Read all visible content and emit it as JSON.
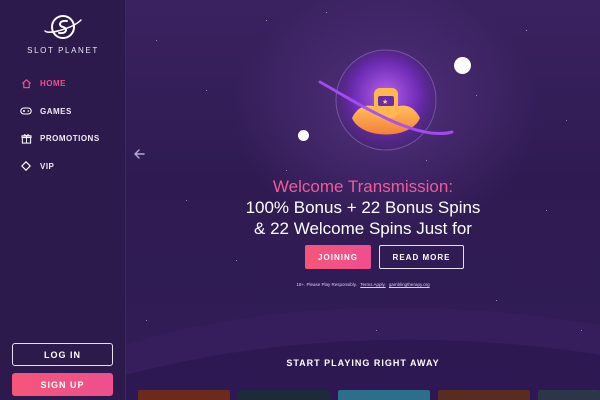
{
  "brand": {
    "name": "SLOT PLANET"
  },
  "sidebar": {
    "items": [
      {
        "label": "HOME",
        "icon": "home-icon",
        "active": true
      },
      {
        "label": "GAMES",
        "icon": "gamepad-icon",
        "active": false
      },
      {
        "label": "PROMOTIONS",
        "icon": "gift-icon",
        "active": false
      },
      {
        "label": "VIP",
        "icon": "diamond-icon",
        "active": false
      }
    ],
    "login_label": "LOG IN",
    "signup_label": "SIGN UP"
  },
  "hero": {
    "headline_line1": "Welcome Transmission:",
    "headline_line2": "100% Bonus + 22 Bonus Spins",
    "headline_line3": "& 22 Welcome Spins Just for",
    "join_label": "JOINING",
    "readmore_label": "READ MORE",
    "disclaimer_text": "18+. Please Play Responsibly.",
    "disclaimer_link1": "Terms Apply.",
    "disclaimer_link2": "gamblingtherapy.org"
  },
  "section": {
    "title": "START PLAYING RIGHT AWAY"
  },
  "colors": {
    "accent_pink": "#f0518a",
    "sidebar_bg": "#2b1a4b",
    "main_bg": "#321c57"
  }
}
